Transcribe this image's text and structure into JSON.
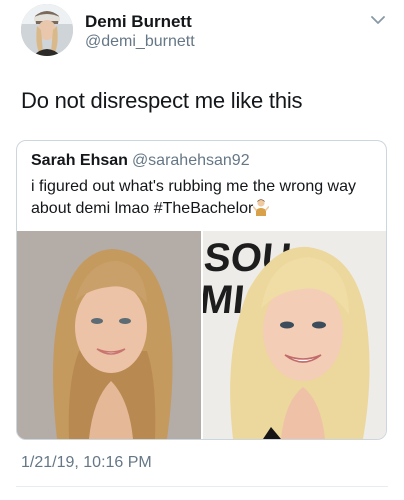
{
  "tweet": {
    "author": {
      "display_name": "Demi Burnett",
      "handle": "@demi_burnett",
      "avatar_icon": "profile-photo"
    },
    "menu_icon": "chevron-down-icon",
    "text": "Do not disrespect me like this",
    "timestamp": "1/21/19, 10:16 PM"
  },
  "quoted_tweet": {
    "display_name": "Sarah Ehsan",
    "handle": "@sarahehsan92",
    "text_line1": "i figured out what's rubbing me the wrong way",
    "text_line2": "about demi lmao #TheBachelor",
    "emoji_icon": "man-shrugging-emoji",
    "images": [
      {
        "name": "photo-left",
        "description_icon": "portrait-photo"
      },
      {
        "name": "photo-right",
        "backdrop_text": "SOU\nMI",
        "description_icon": "portrait-photo"
      }
    ]
  },
  "colors": {
    "text_primary": "#14171a",
    "text_secondary": "#657786",
    "border": "#ccd6dd"
  }
}
